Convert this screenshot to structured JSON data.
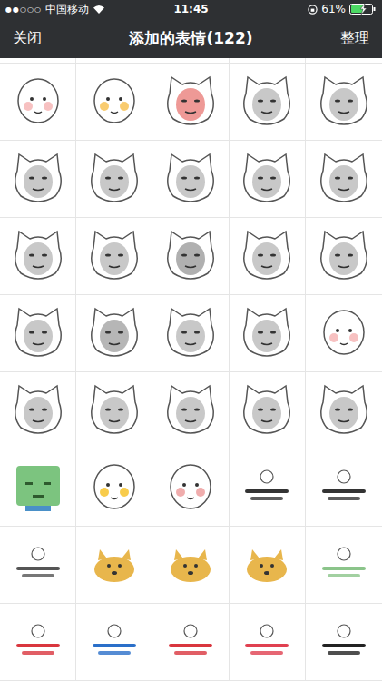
{
  "status_bar": {
    "signal": "●●○○○",
    "carrier": "中国移动",
    "time": "11:45",
    "battery": "61%",
    "battery_level": 0.61,
    "charging": true
  },
  "nav_bar": {
    "left": "关闭",
    "title": "添加的表情(122)",
    "right": "整理"
  },
  "stickers": [
    {
      "kind": "cartoon",
      "color": "#f4a7a7"
    },
    {
      "kind": "cartoon",
      "color": "#f7b733"
    },
    {
      "kind": "meme-face",
      "color": "#e0463f"
    },
    {
      "kind": "meme-face",
      "color": "#9a9a9a"
    },
    {
      "kind": "meme-face",
      "color": "#9a9a9a"
    },
    {
      "kind": "meme-face",
      "color": "#9a9a9a"
    },
    {
      "kind": "meme-face",
      "color": "#9a9a9a"
    },
    {
      "kind": "meme-face",
      "color": "#9a9a9a"
    },
    {
      "kind": "meme-face",
      "color": "#9a9a9a"
    },
    {
      "kind": "meme-face",
      "color": "#9a9a9a"
    },
    {
      "kind": "meme-face",
      "color": "#9a9a9a"
    },
    {
      "kind": "meme-face",
      "color": "#9a9a9a"
    },
    {
      "kind": "meme-face",
      "color": "#6f6f6f"
    },
    {
      "kind": "meme-face",
      "color": "#9a9a9a"
    },
    {
      "kind": "meme-face",
      "color": "#9a9a9a"
    },
    {
      "kind": "meme-face",
      "color": "#9a9a9a"
    },
    {
      "kind": "meme-face",
      "color": "#7a7a7a"
    },
    {
      "kind": "meme-face",
      "color": "#9a9a9a"
    },
    {
      "kind": "meme-face",
      "color": "#9a9a9a"
    },
    {
      "kind": "cartoon",
      "color": "#f4a7a7"
    },
    {
      "kind": "meme-face",
      "color": "#9a9a9a"
    },
    {
      "kind": "meme-face",
      "color": "#9a9a9a"
    },
    {
      "kind": "meme-face",
      "color": "#9a9a9a"
    },
    {
      "kind": "meme-face",
      "color": "#9a9a9a"
    },
    {
      "kind": "meme-face",
      "color": "#9a9a9a"
    },
    {
      "kind": "block",
      "color": "#7cc47f"
    },
    {
      "kind": "cartoon",
      "color": "#f5b700"
    },
    {
      "kind": "cartoon",
      "color": "#e98a8a"
    },
    {
      "kind": "caption",
      "color": "#333333"
    },
    {
      "kind": "caption",
      "color": "#333333"
    },
    {
      "kind": "caption",
      "color": "#555555"
    },
    {
      "kind": "doge",
      "color": "#e8b64c"
    },
    {
      "kind": "doge",
      "color": "#e8b64c"
    },
    {
      "kind": "doge",
      "color": "#e8b64c"
    },
    {
      "kind": "caption",
      "color": "#8bc48a"
    },
    {
      "kind": "caption",
      "color": "#d9363e"
    },
    {
      "kind": "caption",
      "color": "#2a6fc9"
    },
    {
      "kind": "caption",
      "color": "#d9363e"
    },
    {
      "kind": "caption",
      "color": "#e04050"
    },
    {
      "kind": "caption",
      "color": "#222222"
    }
  ]
}
